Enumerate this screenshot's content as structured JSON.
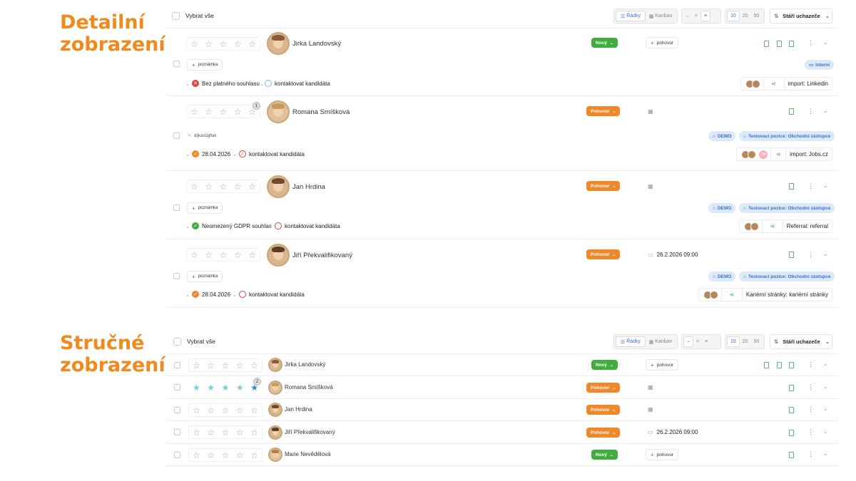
{
  "labels": {
    "detail": "Detailní zobrazení",
    "compact": "Stručné zobrazení"
  },
  "toolbar": {
    "select_all": "Vybrat vše",
    "view_rows": "Řádky",
    "view_kanban": "Kanban",
    "page_sizes": [
      "10",
      "20",
      "50"
    ],
    "sort_label": "Stáří uchazeče"
  },
  "detail_candidates": [
    {
      "name": "Jirka Landovský",
      "status": "Nový",
      "status_color": "#3fae3f",
      "action": "pohovor",
      "note": "poznámka",
      "tags": [
        "Interní"
      ],
      "consent": "Bez platného souhlasu",
      "contact": "kontaktovat kandidáta",
      "source": "import: Linkedin"
    },
    {
      "name": "Romana Smíšková",
      "status": "Pohovor",
      "status_color": "#f0882a",
      "badge": "1",
      "note": "dijkasůgflak",
      "tags": [
        "DEMO",
        "Testovací pozice: Obchodní zástupce"
      ],
      "consent": "28.04.2026",
      "contact": "kontaktovat kandidáta",
      "tm": "TM",
      "source": "import: Jobs.cz"
    },
    {
      "name": "Jan Hrdina",
      "status": "Pohovor",
      "status_color": "#f0882a",
      "note": "poznámka",
      "tags": [
        "DEMO",
        "Testovací pozice: Obchodní zástupce"
      ],
      "consent": "Neomezený GDPR souhlas",
      "contact": "kontaktovat kandidáta",
      "source": "Referral: referral"
    },
    {
      "name": "Jiří Překvalifikovaný",
      "status": "Pohovor",
      "status_color": "#f0882a",
      "date": "26.2.2026 09:00",
      "note": "poznámka",
      "tags": [
        "DEMO",
        "Testovací pozice: Obchodní zástupce"
      ],
      "consent": "28.04.2026",
      "contact": "kontaktovat kandidáta",
      "source": "Kariérní stránky: kariérní stránky"
    }
  ],
  "compact_candidates": [
    {
      "name": "Jirka Landovský",
      "status": "Nový",
      "action": "pohovor"
    },
    {
      "name": "Romana Smíšková",
      "status": "Pohovor",
      "badge": "2",
      "rating": 5
    },
    {
      "name": "Jan Hrdina",
      "status": "Pohovor"
    },
    {
      "name": "Jiří Překvalifikovaný",
      "status": "Pohovor",
      "date": "26.2.2026 09:00"
    },
    {
      "name": "Marie Nevědělová",
      "status": "Nový",
      "action": "pohovor"
    }
  ]
}
